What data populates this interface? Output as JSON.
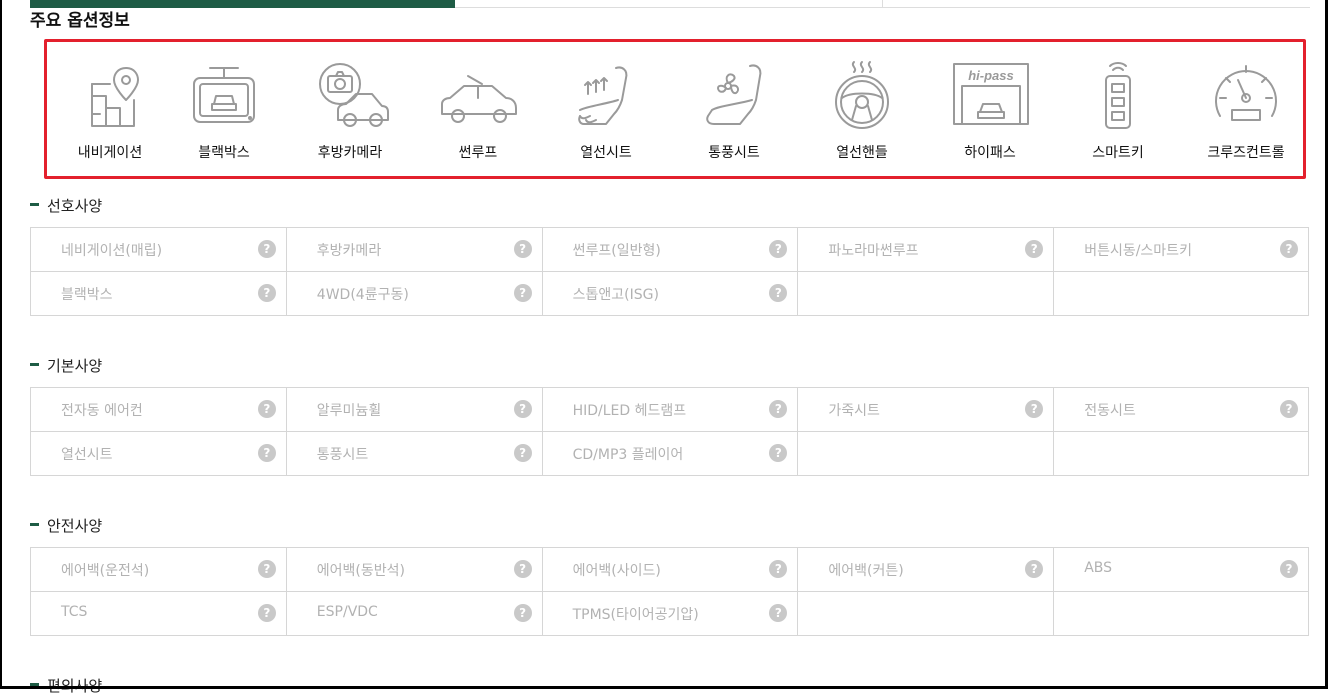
{
  "main_title": "주요 옵션정보",
  "key_options": [
    {
      "label": "내비게이션",
      "icon": "navigation-map-icon"
    },
    {
      "label": "블랙박스",
      "icon": "dashcam-icon"
    },
    {
      "label": "후방카메라",
      "icon": "rear-camera-icon"
    },
    {
      "label": "썬루프",
      "icon": "sunroof-car-icon"
    },
    {
      "label": "열선시트",
      "icon": "heated-seat-icon"
    },
    {
      "label": "통풍시트",
      "icon": "ventilated-seat-icon"
    },
    {
      "label": "열선핸들",
      "icon": "heated-steering-wheel-icon"
    },
    {
      "label": "하이패스",
      "icon": "hipass-gate-icon",
      "badge": "hi-pass"
    },
    {
      "label": "스마트키",
      "icon": "smart-key-icon"
    },
    {
      "label": "크루즈컨트롤",
      "icon": "cruise-control-gauge-icon"
    }
  ],
  "sections": {
    "preferred": {
      "title": "선호사양",
      "rows": [
        [
          "네비게이션(매립)",
          "후방카메라",
          "썬루프(일반형)",
          "파노라마썬루프",
          "버튼시동/스마트키"
        ],
        [
          "블랙박스",
          "4WD(4륜구동)",
          "스톱앤고(ISG)",
          "",
          ""
        ]
      ]
    },
    "basic": {
      "title": "기본사양",
      "rows": [
        [
          "전자동 에어컨",
          "알루미늄휠",
          "HID/LED 헤드램프",
          "가죽시트",
          "전동시트"
        ],
        [
          "열선시트",
          "통풍시트",
          "CD/MP3 플레이어",
          "",
          ""
        ]
      ]
    },
    "safety": {
      "title": "안전사양",
      "rows": [
        [
          "에어백(운전석)",
          "에어백(동반석)",
          "에어백(사이드)",
          "에어백(커튼)",
          "ABS"
        ],
        [
          "TCS",
          "ESP/VDC",
          "TPMS(타이어공기압)",
          "",
          ""
        ]
      ]
    },
    "convenience": {
      "title": "편의사양"
    }
  },
  "help_glyph": "?",
  "colors": {
    "accent_green": "#1e5c45",
    "highlight_red": "#e3202d",
    "muted_text": "#b2b2b2",
    "help_badge": "#c9c9c9"
  }
}
